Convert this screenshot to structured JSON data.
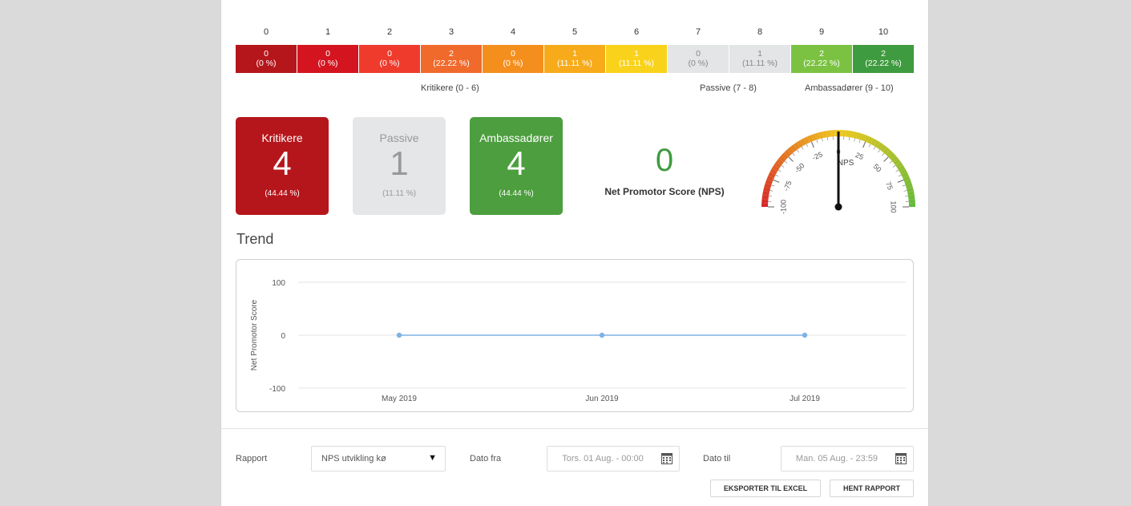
{
  "colors": {
    "critic_card": "#b5161b",
    "passive_card": "#e4e6e8",
    "ambassador_card": "#4c9e3e",
    "nps_green": "#3f9b3f",
    "trend_line": "#7fb2e5"
  },
  "scale": [
    {
      "score": "0",
      "count": "0",
      "pct": "(0 %)",
      "color": "#b5161b",
      "text": "#ffffff"
    },
    {
      "score": "1",
      "count": "0",
      "pct": "(0 %)",
      "color": "#d4141f",
      "text": "#ffffff"
    },
    {
      "score": "2",
      "count": "0",
      "pct": "(0 %)",
      "color": "#ef3b2c",
      "text": "#ffffff"
    },
    {
      "score": "3",
      "count": "2",
      "pct": "(22.22 %)",
      "color": "#f06a2c",
      "text": "#ffffff"
    },
    {
      "score": "4",
      "count": "0",
      "pct": "(0 %)",
      "color": "#f48f1e",
      "text": "#ffffff"
    },
    {
      "score": "5",
      "count": "1",
      "pct": "(11.11 %)",
      "color": "#f7ab1b",
      "text": "#ffffff"
    },
    {
      "score": "6",
      "count": "1",
      "pct": "(11.11 %)",
      "color": "#f9d21b",
      "text": "#ffffff"
    },
    {
      "score": "7",
      "count": "0",
      "pct": "(0 %)",
      "color": "#e3e5e7",
      "text": "#888888"
    },
    {
      "score": "8",
      "count": "1",
      "pct": "(11.11 %)",
      "color": "#e3e5e7",
      "text": "#888888"
    },
    {
      "score": "9",
      "count": "2",
      "pct": "(22.22 %)",
      "color": "#7cc242",
      "text": "#ffffff"
    },
    {
      "score": "10",
      "count": "2",
      "pct": "(22.22 %)",
      "color": "#3f9b3f",
      "text": "#ffffff"
    }
  ],
  "groups": {
    "critics": "Kritikere (0 - 6)",
    "passive": "Passive (7 - 8)",
    "ambassadors": "Ambassadører (9 - 10)"
  },
  "cards": {
    "critics": {
      "title": "Kritikere",
      "count": "4",
      "pct": "(44.44 %)"
    },
    "passive": {
      "title": "Passive",
      "count": "1",
      "pct": "(11.11 %)"
    },
    "ambassadors": {
      "title": "Ambassadører",
      "count": "4",
      "pct": "(44.44 %)"
    }
  },
  "nps": {
    "value": "0",
    "label": "Net Promotor Score (NPS)",
    "gauge": {
      "min": -100,
      "max": 100,
      "value": 0,
      "center_label": "NPS",
      "tick_labels": [
        "-100",
        "-75",
        "-50",
        "-25",
        "0",
        "25",
        "50",
        "75",
        "100"
      ]
    }
  },
  "trend": {
    "title": "Trend"
  },
  "chart_data": {
    "type": "line",
    "title": "",
    "xlabel": "",
    "ylabel": "Net Promotor Score",
    "categories": [
      "May 2019",
      "Jun 2019",
      "Jul 2019"
    ],
    "series": [
      {
        "values": [
          0,
          0,
          0
        ]
      }
    ],
    "ylim": [
      -100,
      100
    ],
    "yticks": [
      "100",
      "0",
      "-100"
    ],
    "grid": true
  },
  "form": {
    "report_label": "Rapport",
    "report_value": "NPS utvikling kø",
    "date_from_label": "Dato fra",
    "date_from_value": "Tors. 01 Aug. - 00:00",
    "date_to_label": "Dato til",
    "date_to_value": "Man. 05 Aug. - 23:59",
    "export_button": "EKSPORTER TIL EXCEL",
    "fetch_button": "HENT RAPPORT"
  }
}
